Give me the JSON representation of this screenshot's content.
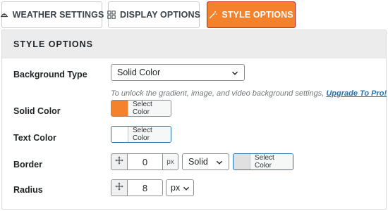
{
  "tabs": [
    {
      "label": "WEATHER SETTINGS",
      "icon": "weather-icon",
      "active": false
    },
    {
      "label": "DISPLAY OPTIONS",
      "icon": "grid-icon",
      "active": false
    },
    {
      "label": "STYLE OPTIONS",
      "icon": "magic-wand-icon",
      "active": true
    }
  ],
  "colors": {
    "accent": "#f4812b",
    "active_border": "#b9262a",
    "link": "#2271b1",
    "text_color_swatch": "#ffffff",
    "border_color_swatch": "#e0e0e0"
  },
  "section": {
    "title": "STYLE OPTIONS"
  },
  "background_type": {
    "label": "Background Type",
    "value": "Solid Color",
    "note_text": "To unlock the gradient, image, and video background settings, ",
    "note_link": "Upgrade To Pro!"
  },
  "solid_color": {
    "label": "Solid Color",
    "button": "Select Color",
    "swatch": "#f4812b"
  },
  "text_color": {
    "label": "Text Color",
    "button": "Select Color",
    "swatch": "#ffffff"
  },
  "border": {
    "label": "Border",
    "width": "0",
    "unit": "px",
    "style": "Solid",
    "color_button": "Select Color",
    "swatch": "#e0e0e0"
  },
  "radius": {
    "label": "Radius",
    "value": "8",
    "unit": "px"
  }
}
